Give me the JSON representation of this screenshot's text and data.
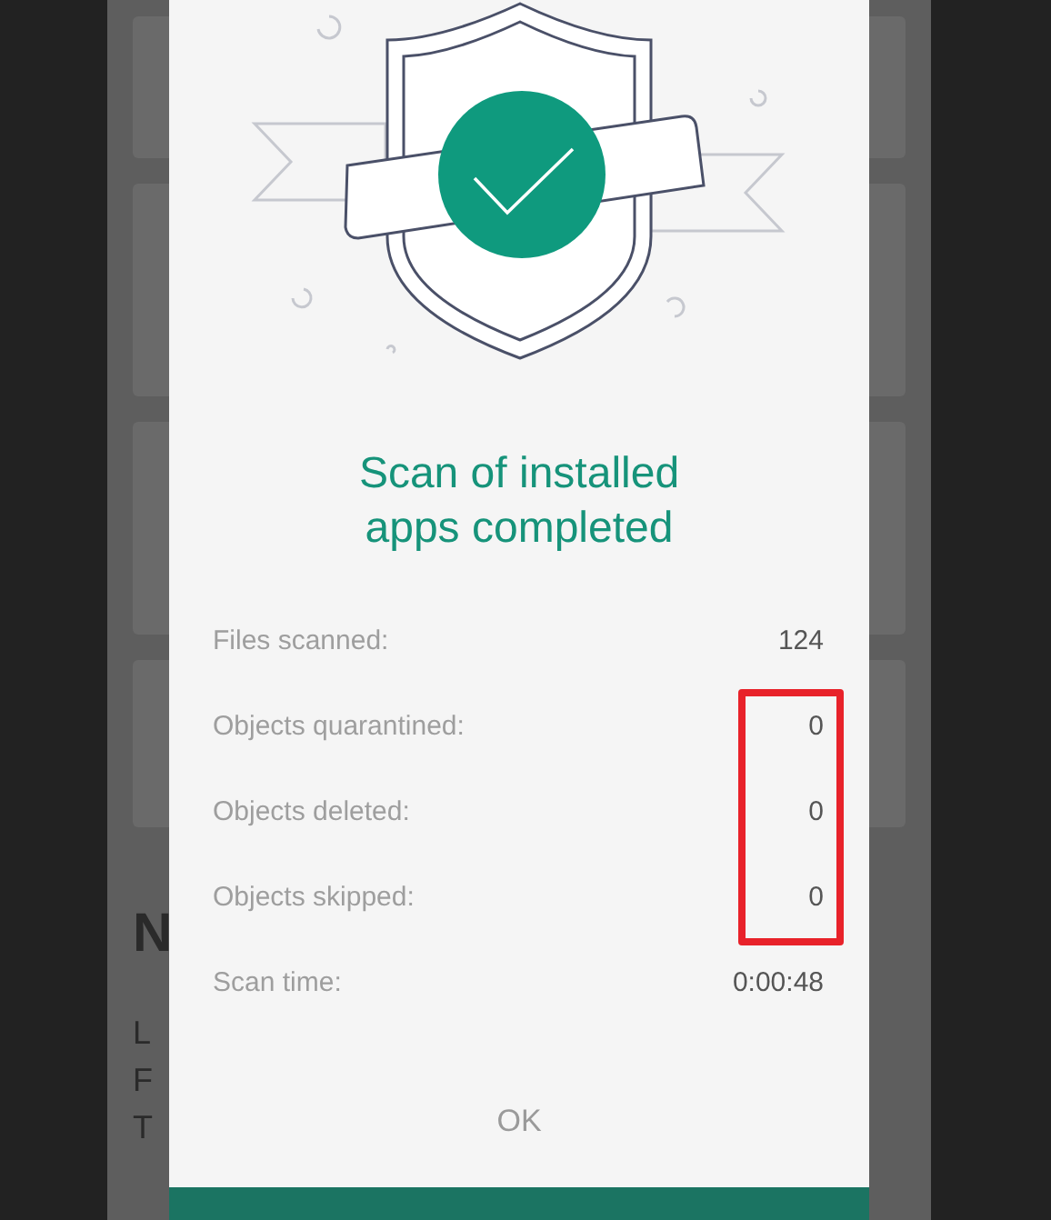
{
  "background": {
    "heading_fragment": "N",
    "line_fragments": [
      "L",
      "F",
      "T"
    ]
  },
  "dialog": {
    "title": "Scan of installed apps completed",
    "stats": [
      {
        "label": "Files scanned:",
        "value": "124",
        "highlighted": false
      },
      {
        "label": "Objects quarantined:",
        "value": "0",
        "highlighted": true
      },
      {
        "label": "Objects deleted:",
        "value": "0",
        "highlighted": true
      },
      {
        "label": "Objects skipped:",
        "value": "0",
        "highlighted": true
      },
      {
        "label": "Scan time:",
        "value": "0:00:48",
        "highlighted": false
      }
    ],
    "button": "OK"
  }
}
